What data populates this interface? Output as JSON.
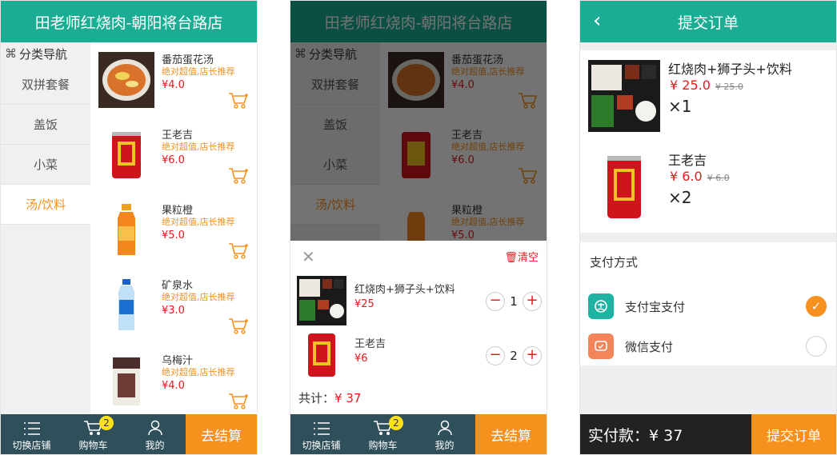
{
  "screen1": {
    "title": "田老师红烧肉-朝阳将台路店",
    "category_header": "分类导航",
    "categories": [
      "双拼套餐",
      "盖饭",
      "小菜",
      "汤/饮料"
    ],
    "active_category": "汤/饮料",
    "products": [
      {
        "name": "番茄蛋花汤",
        "tag": "绝对超值,店长推荐",
        "price": "¥4.0",
        "image": "tomato-egg-soup-image"
      },
      {
        "name": "王老吉",
        "tag": "绝对超值,店长推荐",
        "price": "¥6.0",
        "image": "wanglaoji-can-image"
      },
      {
        "name": "果粒橙",
        "tag": "绝对超值,店长推荐",
        "price": "¥5.0",
        "image": "orange-juice-bottle-image"
      },
      {
        "name": "矿泉水",
        "tag": "绝对超值,店长推荐",
        "price": "¥3.0",
        "image": "water-bottle-image"
      },
      {
        "name": "乌梅汁",
        "tag": "绝对超值,店长推荐",
        "price": "¥4.0",
        "image": "plum-juice-box-image"
      }
    ]
  },
  "screen2": {
    "clear_label": "清空",
    "cart_items": [
      {
        "name": "红烧肉+狮子头+饮料",
        "price": "¥25",
        "qty": "1"
      },
      {
        "name": "王老吉",
        "price": "¥6",
        "qty": "2"
      }
    ],
    "total_label": "共计：",
    "total_value": "¥ 37"
  },
  "screen3": {
    "title": "提交订单",
    "order_items": [
      {
        "name": "红烧肉+狮子头+饮料",
        "price": "¥ 25.0",
        "old_price": "¥ 25.0",
        "qty": "×1"
      },
      {
        "name": "王老吉",
        "price": "¥ 6.0",
        "old_price": "¥ 6.0",
        "qty": "×2"
      }
    ],
    "payment_title": "支付方式",
    "payment_methods": [
      {
        "label": "支付宝支付",
        "selected": true
      },
      {
        "label": "微信支付",
        "selected": false
      }
    ],
    "paid_label": "实付款：¥ 37",
    "submit_label": "提交订单"
  },
  "tabbar": {
    "switch_store": "切换店铺",
    "cart": "购物车",
    "cart_badge": "2",
    "mine": "我的",
    "checkout": "去结算"
  },
  "colors": {
    "brand": "#1aad93",
    "accent": "#f7911d",
    "price": "#e8191d",
    "tabbar": "#2f4f5a"
  }
}
